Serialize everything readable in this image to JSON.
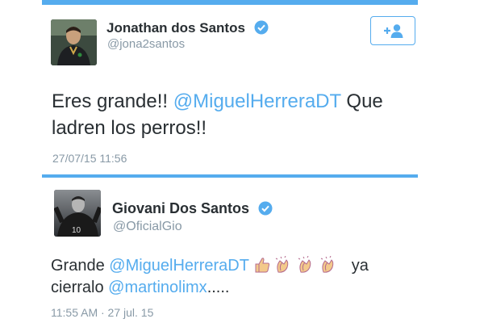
{
  "tweets": [
    {
      "name": "Jonathan dos Santos",
      "handle": "@jona2santos",
      "text_plain": "Eres grande!! ",
      "mention": "@MiguelHerreraDT",
      "text_after": " Que",
      "line2": "ladren los perros!!",
      "timestamp": "27/07/15 11:56"
    },
    {
      "name": "Giovani Dos Santos",
      "handle": "@OficialGio",
      "text_plain": "Grande ",
      "mention": "@MiguelHerreraDT",
      "emojis": [
        "thumbs-up-icon",
        "clapping-hands-icon",
        "clapping-hands-icon",
        "clapping-hands-icon"
      ],
      "text_after": "ya",
      "line2_plain": "cierralo ",
      "line2_mention": "@martinolimx",
      "line2_after": ".....",
      "timestamp": "11:55 AM · 27 jul. 15",
      "jersey_number": "10"
    }
  ],
  "colors": {
    "accent": "#55acee",
    "text": "#292f33",
    "muted": "#8899a6"
  }
}
